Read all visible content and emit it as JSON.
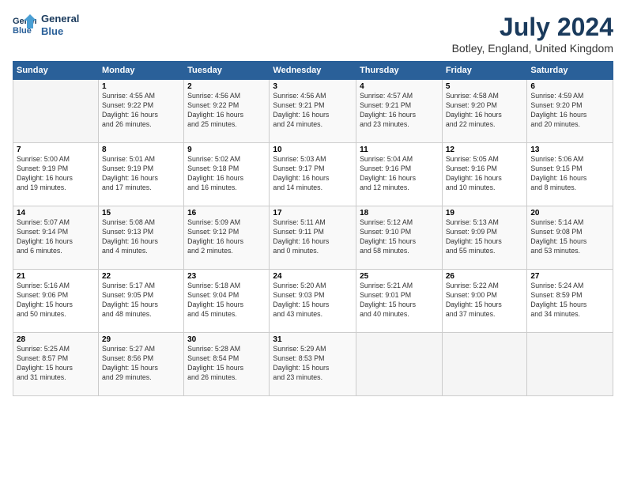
{
  "logo": {
    "line1": "General",
    "line2": "Blue"
  },
  "title": "July 2024",
  "subtitle": "Botley, England, United Kingdom",
  "days_header": [
    "Sunday",
    "Monday",
    "Tuesday",
    "Wednesday",
    "Thursday",
    "Friday",
    "Saturday"
  ],
  "weeks": [
    [
      {
        "num": "",
        "info": ""
      },
      {
        "num": "1",
        "info": "Sunrise: 4:55 AM\nSunset: 9:22 PM\nDaylight: 16 hours\nand 26 minutes."
      },
      {
        "num": "2",
        "info": "Sunrise: 4:56 AM\nSunset: 9:22 PM\nDaylight: 16 hours\nand 25 minutes."
      },
      {
        "num": "3",
        "info": "Sunrise: 4:56 AM\nSunset: 9:21 PM\nDaylight: 16 hours\nand 24 minutes."
      },
      {
        "num": "4",
        "info": "Sunrise: 4:57 AM\nSunset: 9:21 PM\nDaylight: 16 hours\nand 23 minutes."
      },
      {
        "num": "5",
        "info": "Sunrise: 4:58 AM\nSunset: 9:20 PM\nDaylight: 16 hours\nand 22 minutes."
      },
      {
        "num": "6",
        "info": "Sunrise: 4:59 AM\nSunset: 9:20 PM\nDaylight: 16 hours\nand 20 minutes."
      }
    ],
    [
      {
        "num": "7",
        "info": "Sunrise: 5:00 AM\nSunset: 9:19 PM\nDaylight: 16 hours\nand 19 minutes."
      },
      {
        "num": "8",
        "info": "Sunrise: 5:01 AM\nSunset: 9:19 PM\nDaylight: 16 hours\nand 17 minutes."
      },
      {
        "num": "9",
        "info": "Sunrise: 5:02 AM\nSunset: 9:18 PM\nDaylight: 16 hours\nand 16 minutes."
      },
      {
        "num": "10",
        "info": "Sunrise: 5:03 AM\nSunset: 9:17 PM\nDaylight: 16 hours\nand 14 minutes."
      },
      {
        "num": "11",
        "info": "Sunrise: 5:04 AM\nSunset: 9:16 PM\nDaylight: 16 hours\nand 12 minutes."
      },
      {
        "num": "12",
        "info": "Sunrise: 5:05 AM\nSunset: 9:16 PM\nDaylight: 16 hours\nand 10 minutes."
      },
      {
        "num": "13",
        "info": "Sunrise: 5:06 AM\nSunset: 9:15 PM\nDaylight: 16 hours\nand 8 minutes."
      }
    ],
    [
      {
        "num": "14",
        "info": "Sunrise: 5:07 AM\nSunset: 9:14 PM\nDaylight: 16 hours\nand 6 minutes."
      },
      {
        "num": "15",
        "info": "Sunrise: 5:08 AM\nSunset: 9:13 PM\nDaylight: 16 hours\nand 4 minutes."
      },
      {
        "num": "16",
        "info": "Sunrise: 5:09 AM\nSunset: 9:12 PM\nDaylight: 16 hours\nand 2 minutes."
      },
      {
        "num": "17",
        "info": "Sunrise: 5:11 AM\nSunset: 9:11 PM\nDaylight: 16 hours\nand 0 minutes."
      },
      {
        "num": "18",
        "info": "Sunrise: 5:12 AM\nSunset: 9:10 PM\nDaylight: 15 hours\nand 58 minutes."
      },
      {
        "num": "19",
        "info": "Sunrise: 5:13 AM\nSunset: 9:09 PM\nDaylight: 15 hours\nand 55 minutes."
      },
      {
        "num": "20",
        "info": "Sunrise: 5:14 AM\nSunset: 9:08 PM\nDaylight: 15 hours\nand 53 minutes."
      }
    ],
    [
      {
        "num": "21",
        "info": "Sunrise: 5:16 AM\nSunset: 9:06 PM\nDaylight: 15 hours\nand 50 minutes."
      },
      {
        "num": "22",
        "info": "Sunrise: 5:17 AM\nSunset: 9:05 PM\nDaylight: 15 hours\nand 48 minutes."
      },
      {
        "num": "23",
        "info": "Sunrise: 5:18 AM\nSunset: 9:04 PM\nDaylight: 15 hours\nand 45 minutes."
      },
      {
        "num": "24",
        "info": "Sunrise: 5:20 AM\nSunset: 9:03 PM\nDaylight: 15 hours\nand 43 minutes."
      },
      {
        "num": "25",
        "info": "Sunrise: 5:21 AM\nSunset: 9:01 PM\nDaylight: 15 hours\nand 40 minutes."
      },
      {
        "num": "26",
        "info": "Sunrise: 5:22 AM\nSunset: 9:00 PM\nDaylight: 15 hours\nand 37 minutes."
      },
      {
        "num": "27",
        "info": "Sunrise: 5:24 AM\nSunset: 8:59 PM\nDaylight: 15 hours\nand 34 minutes."
      }
    ],
    [
      {
        "num": "28",
        "info": "Sunrise: 5:25 AM\nSunset: 8:57 PM\nDaylight: 15 hours\nand 31 minutes."
      },
      {
        "num": "29",
        "info": "Sunrise: 5:27 AM\nSunset: 8:56 PM\nDaylight: 15 hours\nand 29 minutes."
      },
      {
        "num": "30",
        "info": "Sunrise: 5:28 AM\nSunset: 8:54 PM\nDaylight: 15 hours\nand 26 minutes."
      },
      {
        "num": "31",
        "info": "Sunrise: 5:29 AM\nSunset: 8:53 PM\nDaylight: 15 hours\nand 23 minutes."
      },
      {
        "num": "",
        "info": ""
      },
      {
        "num": "",
        "info": ""
      },
      {
        "num": "",
        "info": ""
      }
    ]
  ]
}
